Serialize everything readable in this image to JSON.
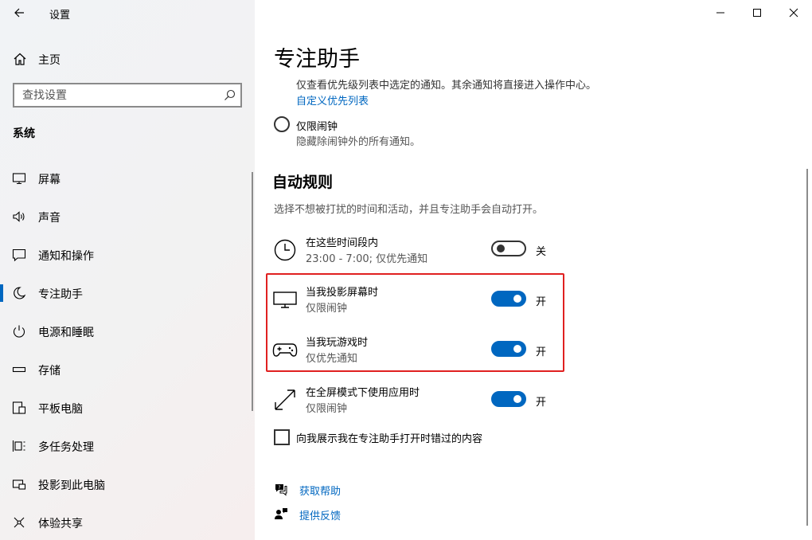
{
  "window": {
    "title": "设置"
  },
  "sidebar": {
    "home_label": "主页",
    "search_placeholder": "查找设置",
    "group_label": "系统",
    "items": [
      {
        "label": "屏幕",
        "icon": "monitor-icon"
      },
      {
        "label": "声音",
        "icon": "speaker-icon"
      },
      {
        "label": "通知和操作",
        "icon": "notification-icon"
      },
      {
        "label": "专注助手",
        "icon": "moon-icon",
        "active": true
      },
      {
        "label": "电源和睡眠",
        "icon": "power-icon"
      },
      {
        "label": "存储",
        "icon": "storage-icon"
      },
      {
        "label": "平板电脑",
        "icon": "tablet-icon"
      },
      {
        "label": "多任务处理",
        "icon": "multitask-icon"
      },
      {
        "label": "投影到此电脑",
        "icon": "project-icon"
      },
      {
        "label": "体验共享",
        "icon": "share-icon"
      }
    ]
  },
  "main": {
    "title": "专注助手",
    "priority_desc": "仅查看优先级列表中选定的通知。其余通知将直接进入操作中心。",
    "priority_link": "自定义优先列表",
    "alarms_only": {
      "label": "仅限闹钟",
      "desc": "隐藏除闹钟外的所有通知。"
    },
    "auto_rules": {
      "title": "自动规则",
      "desc": "选择不想被打扰的时间和活动，并且专注助手会自动打开。",
      "rules": [
        {
          "name": "在这些时间段内",
          "sub": "23:00 - 7:00; 仅优先通知",
          "state": "关",
          "on": false,
          "icon": "clock-icon"
        },
        {
          "name": "当我投影屏幕时",
          "sub": "仅限闹钟",
          "state": "开",
          "on": true,
          "icon": "monitor-icon"
        },
        {
          "name": "当我玩游戏时",
          "sub": "仅优先通知",
          "state": "开",
          "on": true,
          "icon": "gamepad-icon"
        },
        {
          "name": "在全屏模式下使用应用时",
          "sub": "仅限闹钟",
          "state": "开",
          "on": true,
          "icon": "fullscreen-icon"
        }
      ]
    },
    "missed_checkbox": "向我展示我在专注助手打开时错过的内容",
    "help": {
      "get_help": "获取帮助",
      "feedback": "提供反馈"
    }
  },
  "colors": {
    "accent": "#0067c0",
    "highlight": "#e02020"
  }
}
